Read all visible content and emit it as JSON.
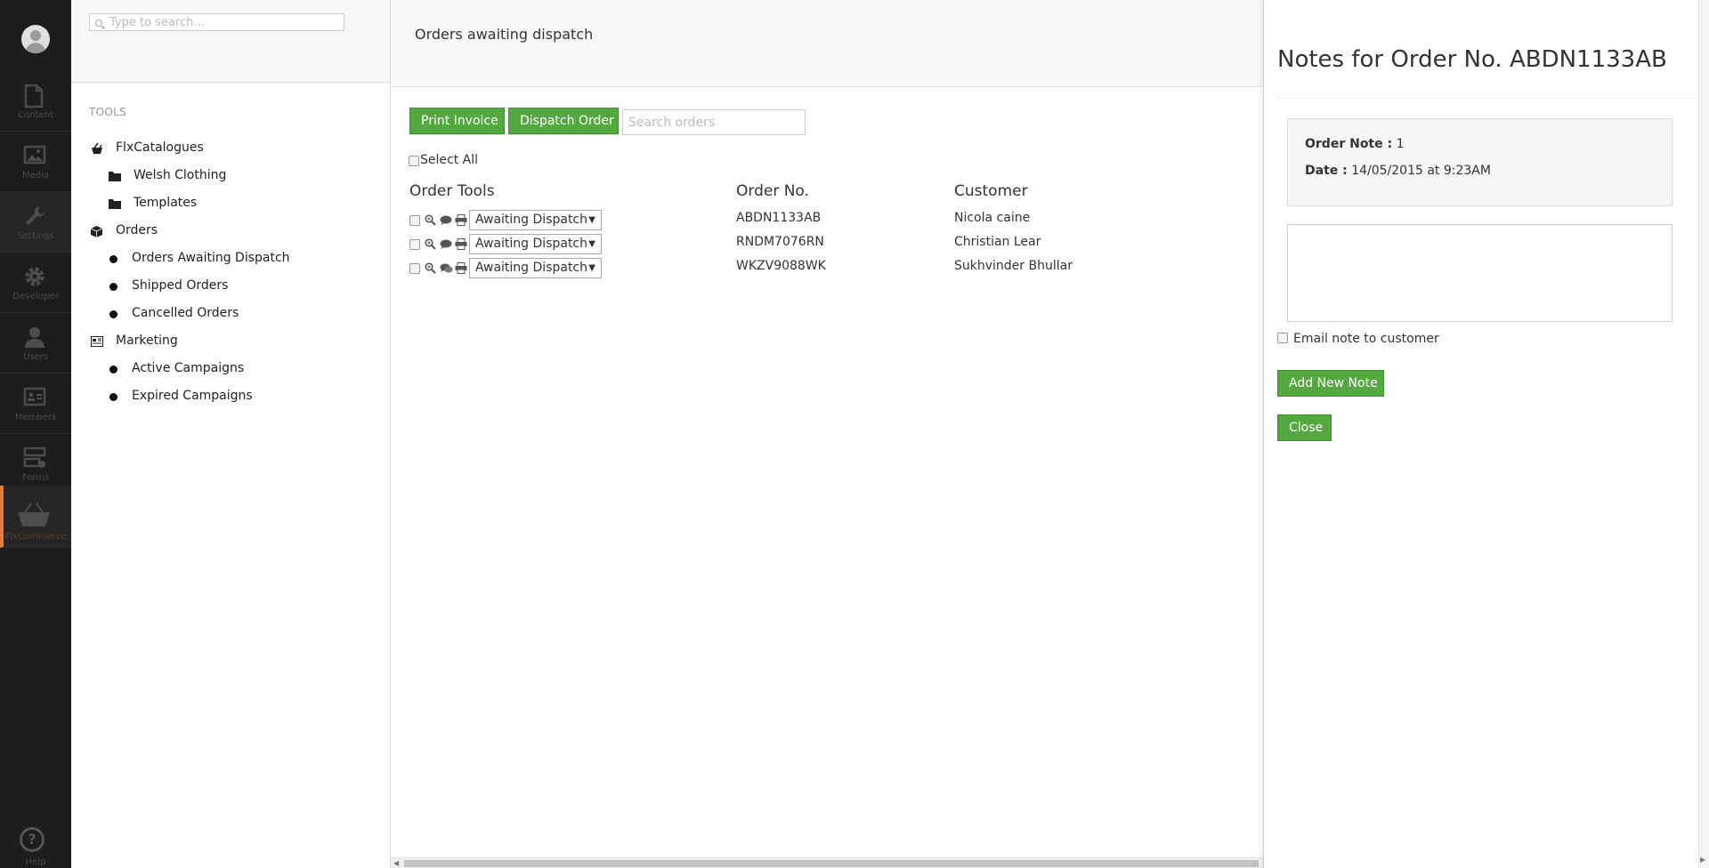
{
  "rail": {
    "items": [
      {
        "label": "Content",
        "icon": "document-icon"
      },
      {
        "label": "Media",
        "icon": "image-icon"
      },
      {
        "label": "Settings",
        "icon": "wrench-icon"
      },
      {
        "label": "Developer",
        "icon": "gear-icon"
      },
      {
        "label": "Users",
        "icon": "user-icon"
      },
      {
        "label": "Members",
        "icon": "id-card-icon"
      },
      {
        "label": "Forms",
        "icon": "forms-icon"
      },
      {
        "label": "FlxCommerce",
        "icon": "basket-icon"
      }
    ],
    "help_label": "Help",
    "active_color": "#e57b3a"
  },
  "tree": {
    "search_placeholder": "Type to search...",
    "section_title": "TOOLS",
    "nodes": [
      {
        "label": "FlxCatalogues"
      },
      {
        "label": "Welsh Clothing"
      },
      {
        "label": "Templates"
      },
      {
        "label": "Orders"
      },
      {
        "label": "Orders Awaiting Dispatch"
      },
      {
        "label": "Shipped Orders"
      },
      {
        "label": "Cancelled Orders"
      },
      {
        "label": "Marketing"
      },
      {
        "label": "Active Campaigns"
      },
      {
        "label": "Expired Campaigns"
      }
    ]
  },
  "main": {
    "title": "Orders awaiting dispatch",
    "print_invoice_label": "Print Invoice",
    "dispatch_order_label": "Dispatch Order",
    "search_placeholder": "Search orders",
    "select_all_label": "Select All",
    "columns": {
      "tools": "Order Tools",
      "order_no": "Order No.",
      "customer": "Customer"
    },
    "rows": [
      {
        "status": "Awaiting Dispatch",
        "order_no": "ABDN1133AB",
        "customer": "Nicola caine"
      },
      {
        "status": "Awaiting Dispatch",
        "order_no": "RNDM7076RN",
        "customer": "Christian Lear"
      },
      {
        "status": "Awaiting Dispatch",
        "order_no": "WKZV9088WK",
        "customer": "Sukhvinder Bhullar"
      }
    ]
  },
  "notes": {
    "title": "Notes for Order No. ABDN1133AB",
    "note_label": "Order Note :",
    "note_value": "1",
    "date_label": "Date :",
    "date_value": "14/05/2015 at 9:23AM",
    "email_label": "Email note to customer",
    "add_label": "Add New Note",
    "close_label": "Close"
  },
  "colors": {
    "button_green": "#53a93f",
    "rail_bg": "#1d1d1d"
  }
}
